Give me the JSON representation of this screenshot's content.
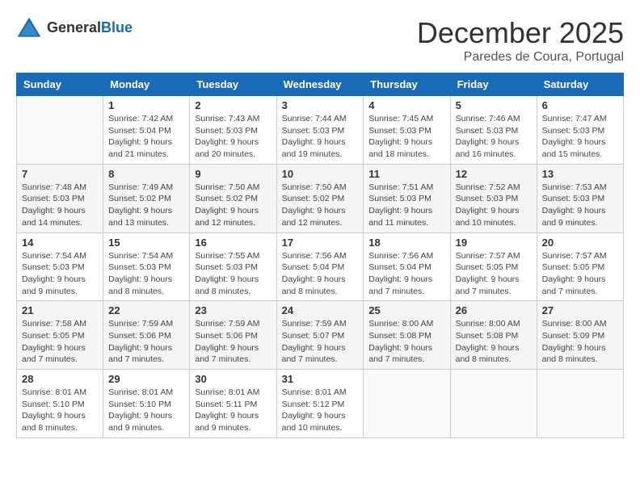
{
  "logo": {
    "text_general": "General",
    "text_blue": "Blue"
  },
  "title": "December 2025",
  "location": "Paredes de Coura, Portugal",
  "days_of_week": [
    "Sunday",
    "Monday",
    "Tuesday",
    "Wednesday",
    "Thursday",
    "Friday",
    "Saturday"
  ],
  "weeks": [
    [
      {
        "num": "",
        "info": ""
      },
      {
        "num": "1",
        "info": "Sunrise: 7:42 AM\nSunset: 5:04 PM\nDaylight: 9 hours\nand 21 minutes."
      },
      {
        "num": "2",
        "info": "Sunrise: 7:43 AM\nSunset: 5:03 PM\nDaylight: 9 hours\nand 20 minutes."
      },
      {
        "num": "3",
        "info": "Sunrise: 7:44 AM\nSunset: 5:03 PM\nDaylight: 9 hours\nand 19 minutes."
      },
      {
        "num": "4",
        "info": "Sunrise: 7:45 AM\nSunset: 5:03 PM\nDaylight: 9 hours\nand 18 minutes."
      },
      {
        "num": "5",
        "info": "Sunrise: 7:46 AM\nSunset: 5:03 PM\nDaylight: 9 hours\nand 16 minutes."
      },
      {
        "num": "6",
        "info": "Sunrise: 7:47 AM\nSunset: 5:03 PM\nDaylight: 9 hours\nand 15 minutes."
      }
    ],
    [
      {
        "num": "7",
        "info": "Sunrise: 7:48 AM\nSunset: 5:03 PM\nDaylight: 9 hours\nand 14 minutes."
      },
      {
        "num": "8",
        "info": "Sunrise: 7:49 AM\nSunset: 5:02 PM\nDaylight: 9 hours\nand 13 minutes."
      },
      {
        "num": "9",
        "info": "Sunrise: 7:50 AM\nSunset: 5:02 PM\nDaylight: 9 hours\nand 12 minutes."
      },
      {
        "num": "10",
        "info": "Sunrise: 7:50 AM\nSunset: 5:02 PM\nDaylight: 9 hours\nand 12 minutes."
      },
      {
        "num": "11",
        "info": "Sunrise: 7:51 AM\nSunset: 5:03 PM\nDaylight: 9 hours\nand 11 minutes."
      },
      {
        "num": "12",
        "info": "Sunrise: 7:52 AM\nSunset: 5:03 PM\nDaylight: 9 hours\nand 10 minutes."
      },
      {
        "num": "13",
        "info": "Sunrise: 7:53 AM\nSunset: 5:03 PM\nDaylight: 9 hours\nand 9 minutes."
      }
    ],
    [
      {
        "num": "14",
        "info": "Sunrise: 7:54 AM\nSunset: 5:03 PM\nDaylight: 9 hours\nand 9 minutes."
      },
      {
        "num": "15",
        "info": "Sunrise: 7:54 AM\nSunset: 5:03 PM\nDaylight: 9 hours\nand 8 minutes."
      },
      {
        "num": "16",
        "info": "Sunrise: 7:55 AM\nSunset: 5:03 PM\nDaylight: 9 hours\nand 8 minutes."
      },
      {
        "num": "17",
        "info": "Sunrise: 7:56 AM\nSunset: 5:04 PM\nDaylight: 9 hours\nand 8 minutes."
      },
      {
        "num": "18",
        "info": "Sunrise: 7:56 AM\nSunset: 5:04 PM\nDaylight: 9 hours\nand 7 minutes."
      },
      {
        "num": "19",
        "info": "Sunrise: 7:57 AM\nSunset: 5:05 PM\nDaylight: 9 hours\nand 7 minutes."
      },
      {
        "num": "20",
        "info": "Sunrise: 7:57 AM\nSunset: 5:05 PM\nDaylight: 9 hours\nand 7 minutes."
      }
    ],
    [
      {
        "num": "21",
        "info": "Sunrise: 7:58 AM\nSunset: 5:05 PM\nDaylight: 9 hours\nand 7 minutes."
      },
      {
        "num": "22",
        "info": "Sunrise: 7:59 AM\nSunset: 5:06 PM\nDaylight: 9 hours\nand 7 minutes."
      },
      {
        "num": "23",
        "info": "Sunrise: 7:59 AM\nSunset: 5:06 PM\nDaylight: 9 hours\nand 7 minutes."
      },
      {
        "num": "24",
        "info": "Sunrise: 7:59 AM\nSunset: 5:07 PM\nDaylight: 9 hours\nand 7 minutes."
      },
      {
        "num": "25",
        "info": "Sunrise: 8:00 AM\nSunset: 5:08 PM\nDaylight: 9 hours\nand 7 minutes."
      },
      {
        "num": "26",
        "info": "Sunrise: 8:00 AM\nSunset: 5:08 PM\nDaylight: 9 hours\nand 8 minutes."
      },
      {
        "num": "27",
        "info": "Sunrise: 8:00 AM\nSunset: 5:09 PM\nDaylight: 9 hours\nand 8 minutes."
      }
    ],
    [
      {
        "num": "28",
        "info": "Sunrise: 8:01 AM\nSunset: 5:10 PM\nDaylight: 9 hours\nand 8 minutes."
      },
      {
        "num": "29",
        "info": "Sunrise: 8:01 AM\nSunset: 5:10 PM\nDaylight: 9 hours\nand 9 minutes."
      },
      {
        "num": "30",
        "info": "Sunrise: 8:01 AM\nSunset: 5:11 PM\nDaylight: 9 hours\nand 9 minutes."
      },
      {
        "num": "31",
        "info": "Sunrise: 8:01 AM\nSunset: 5:12 PM\nDaylight: 9 hours\nand 10 minutes."
      },
      {
        "num": "",
        "info": ""
      },
      {
        "num": "",
        "info": ""
      },
      {
        "num": "",
        "info": ""
      }
    ]
  ]
}
